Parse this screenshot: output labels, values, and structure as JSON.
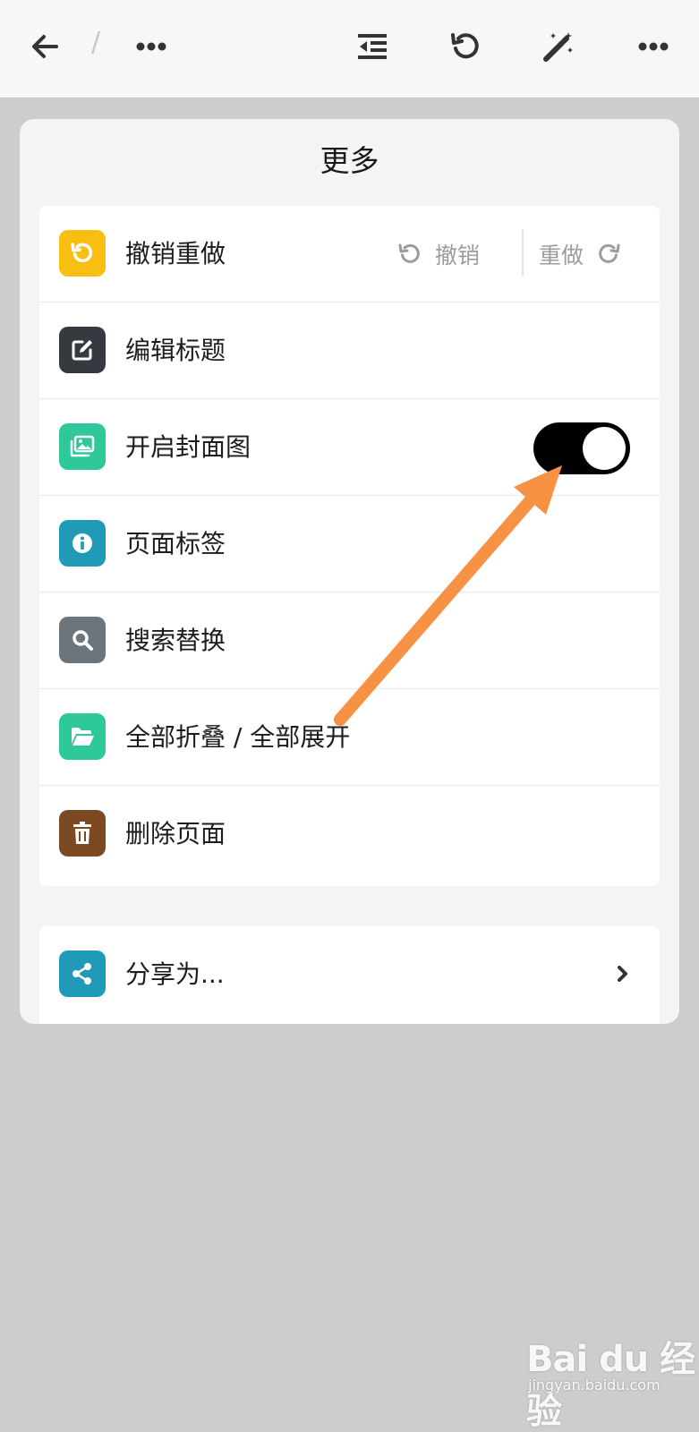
{
  "toolbar": {
    "separator": "/"
  },
  "sheet": {
    "title": "更多"
  },
  "menu": {
    "undo_redo": {
      "label": "撤销重做",
      "undo": "撤销",
      "redo": "重做"
    },
    "edit_title": {
      "label": "编辑标题"
    },
    "cover": {
      "label": "开启封面图",
      "toggle_on": true
    },
    "tags": {
      "label": "页面标签"
    },
    "search": {
      "label": "搜索替换"
    },
    "fold": {
      "label": "全部折叠 / 全部展开"
    },
    "delete": {
      "label": "删除页面"
    },
    "share": {
      "label": "分享为..."
    }
  },
  "icons": {
    "back": "arrow-left-icon",
    "more": "ellipsis-icon",
    "outdent": "outdent-icon",
    "undo": "undo-icon",
    "magic": "magic-wand-icon",
    "redo": "redo-icon",
    "edit": "edit-icon",
    "image": "image-icon",
    "info": "info-icon",
    "search": "search-icon",
    "folder": "folder-open-icon",
    "trash": "trash-icon",
    "share": "share-icon",
    "chevron": "chevron-right-icon"
  },
  "colors": {
    "undo_redo_icon_bg": "#f8bf12",
    "edit_icon_bg": "#363a40",
    "cover_icon_bg": "#2ec89a",
    "tags_icon_bg": "#1f9bb8",
    "search_icon_bg": "#6c747c",
    "fold_icon_bg": "#2ec89a",
    "delete_icon_bg": "#7b4a22",
    "share_icon_bg": "#1f9bb8",
    "toggle_on": "#000000",
    "annotation_arrow": "#f79244"
  },
  "watermark": {
    "logo": "Bai du 经验",
    "url": "jingyan.baidu.com"
  }
}
